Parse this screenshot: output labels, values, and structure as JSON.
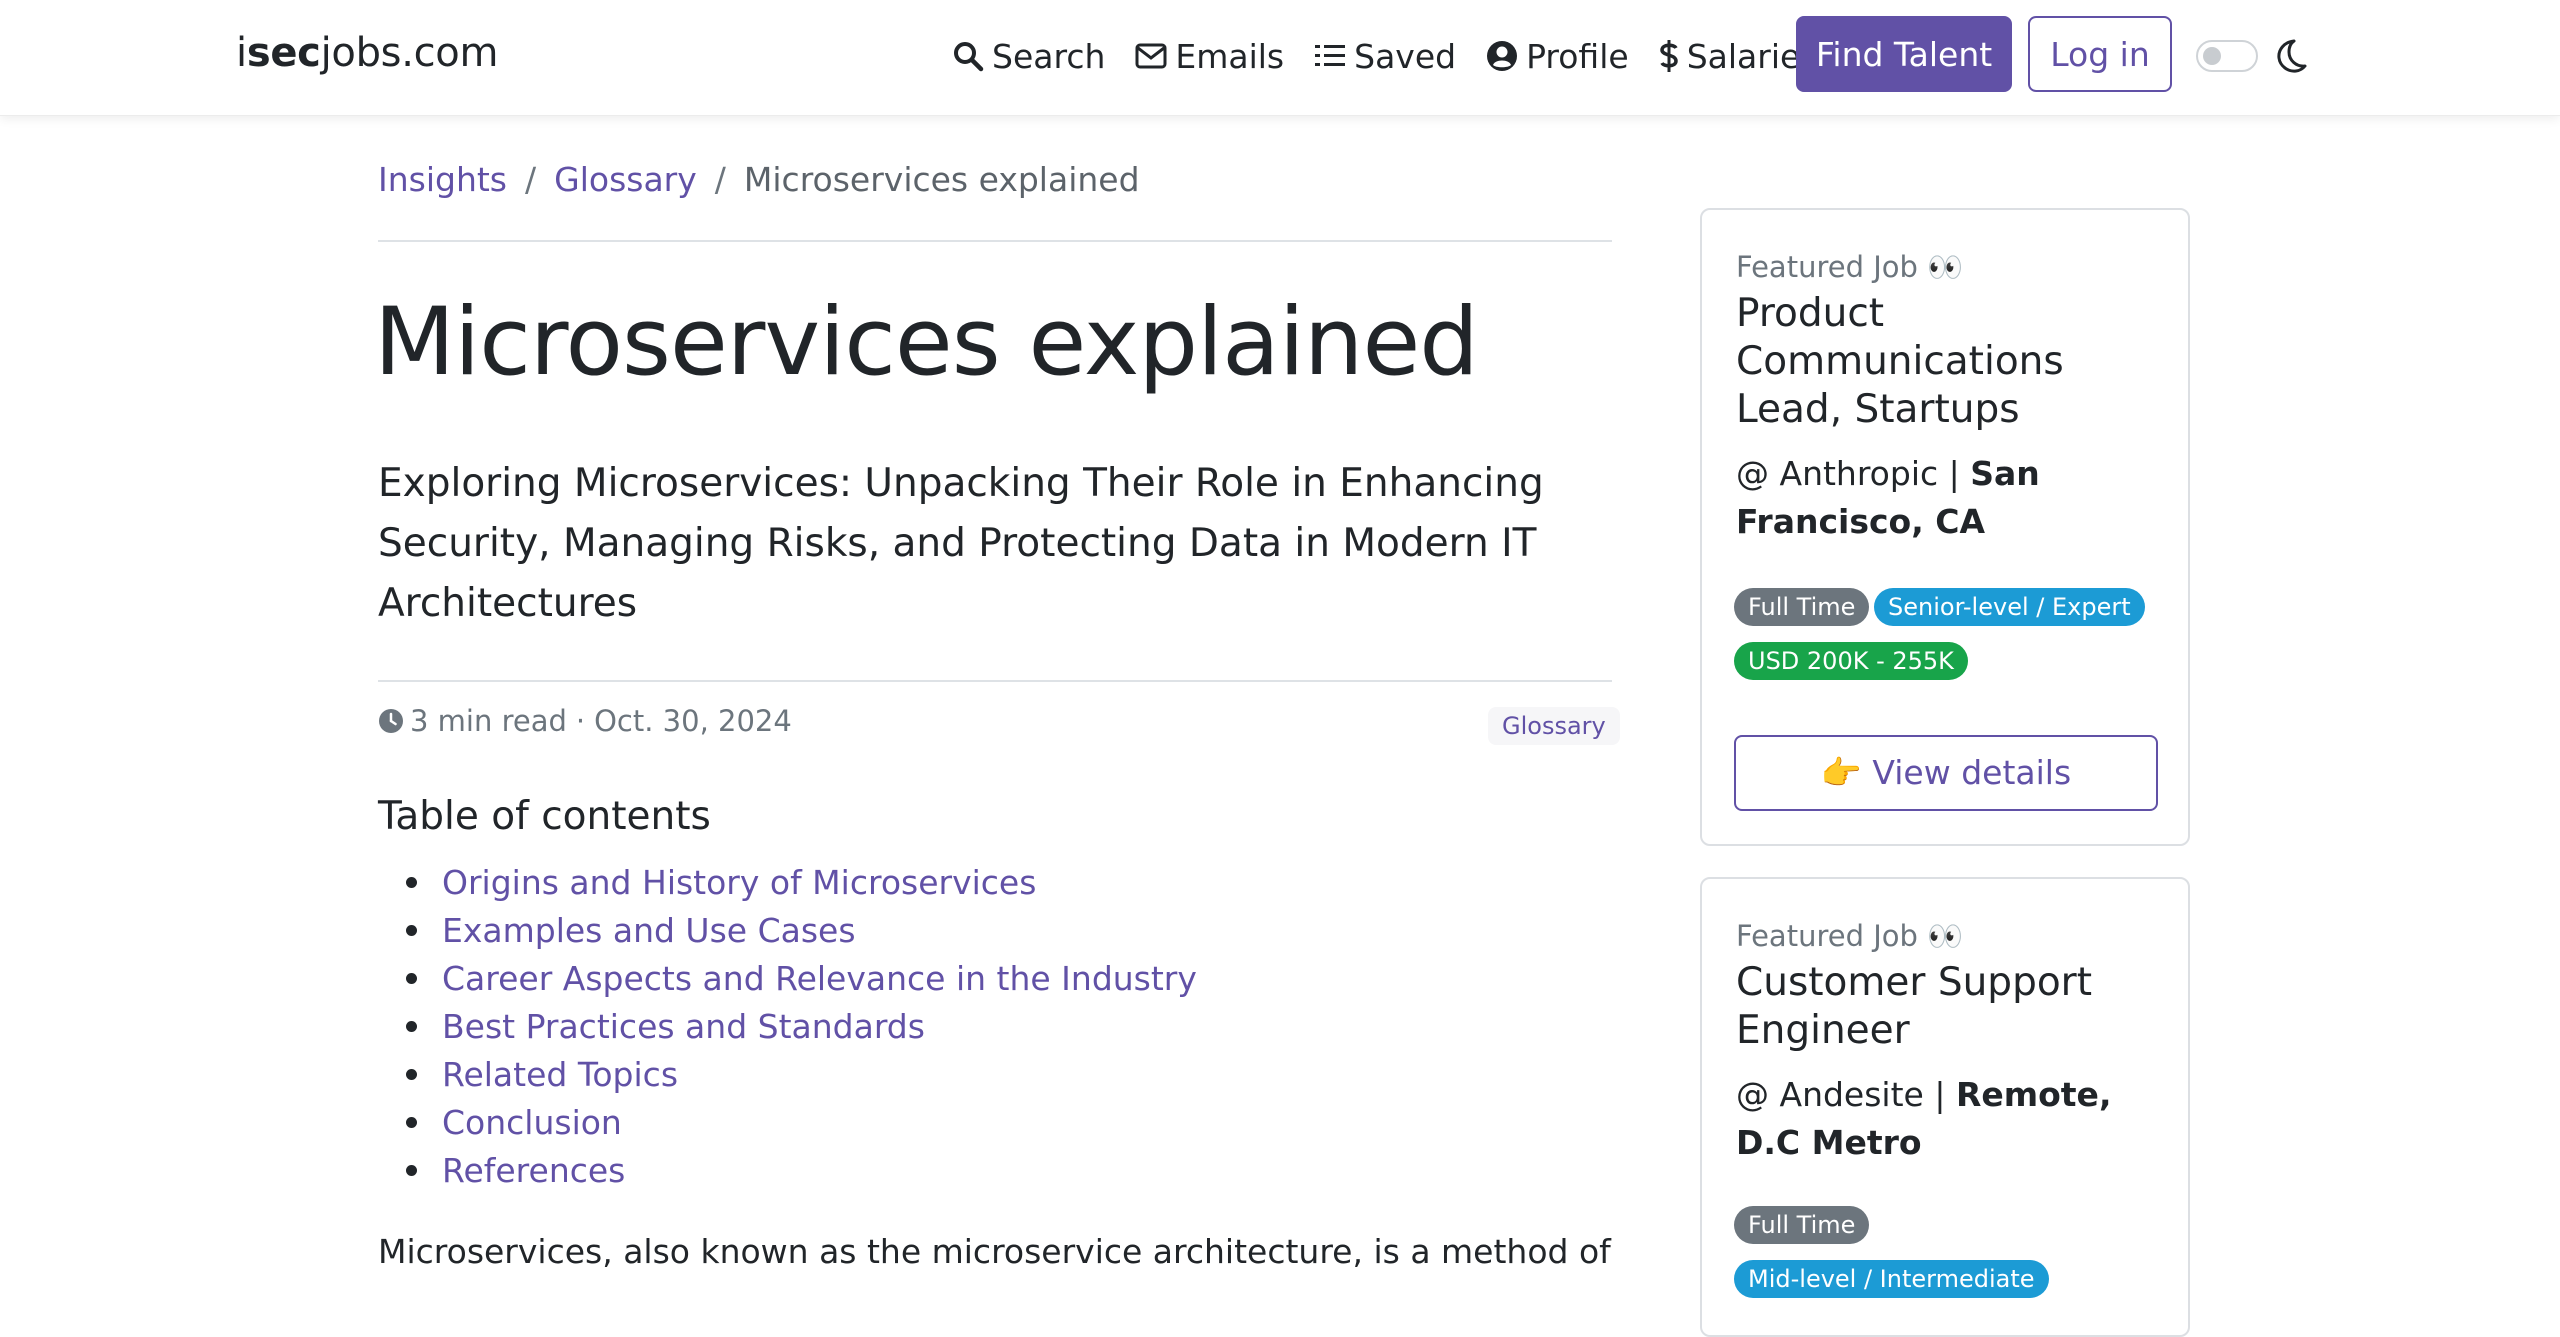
{
  "brand": {
    "prefix": "i",
    "bold": "sec",
    "suffix": "jobs.com"
  },
  "nav": {
    "links": [
      {
        "label": "Search",
        "icon": "search-icon"
      },
      {
        "label": "Emails",
        "icon": "envelope-icon"
      },
      {
        "label": "Saved",
        "icon": "list-icon"
      },
      {
        "label": "Profile",
        "icon": "user-circle-icon"
      },
      {
        "label": "Salaries",
        "icon": "dollar-icon"
      }
    ],
    "find_talent": "Find Talent",
    "login": "Log in",
    "theme_toggle_icon": "moon-icon"
  },
  "breadcrumb": {
    "items": [
      "Insights",
      "Glossary"
    ],
    "separator": "/",
    "current": "Microservices explained"
  },
  "article": {
    "title": "Microservices explained",
    "lead": "Exploring Microservices: Unpacking Their Role in Enhancing Security, Managing Risks, and Protecting Data in Modern IT Architectures",
    "read_time": "3 min read",
    "meta_separator": "·",
    "date": "Oct. 30, 2024",
    "tag": "Glossary",
    "toc_title": "Table of contents",
    "toc": [
      "Origins and History of Microservices",
      "Examples and Use Cases",
      "Career Aspects and Relevance in the Industry",
      "Best Practices and Standards",
      "Related Topics",
      "Conclusion",
      "References"
    ],
    "body_first_line": "Microservices, also known as the microservice architecture, is a method of"
  },
  "featured_jobs": [
    {
      "eyebrow": "Featured Job 👀",
      "title": "Product Communications Lead, Startups",
      "company_prefix": "@ Anthropic | ",
      "location": "San Francisco, CA",
      "badges": [
        "Full Time",
        "Senior-level / Expert",
        "USD 200K - 255K"
      ],
      "button": "👉 View details"
    },
    {
      "eyebrow": "Featured Job 👀",
      "title": "Customer Support Engineer",
      "company_prefix": "@ Andesite | ",
      "location": "Remote, D.C Metro",
      "badges": [
        "Full Time",
        "Mid-level / Intermediate"
      ]
    }
  ],
  "colors": {
    "primary": "#6151a6",
    "badge_gray": "#6c757d",
    "badge_blue": "#1c9bd5",
    "badge_green": "#18a44a"
  }
}
